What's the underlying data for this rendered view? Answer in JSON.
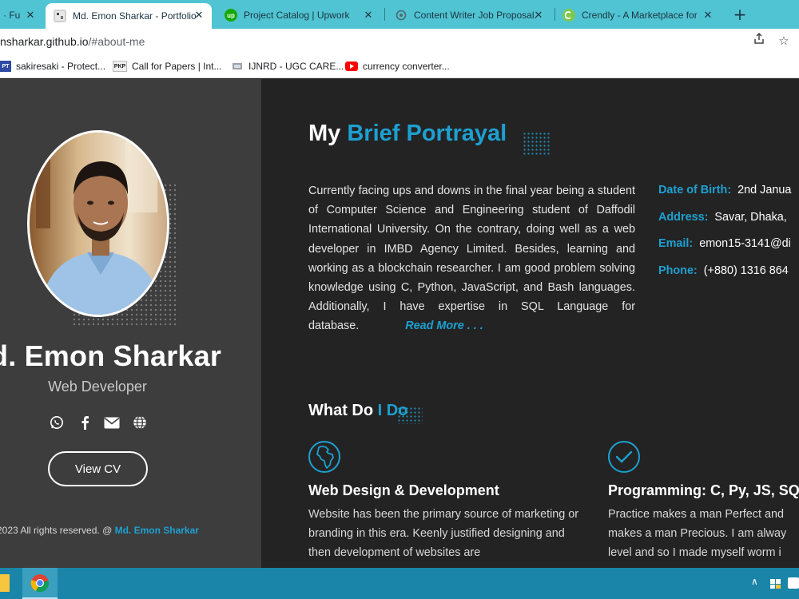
{
  "browser": {
    "tabs": [
      {
        "title": "· Fu",
        "favicon": "generic-icon",
        "active": false
      },
      {
        "title": "Md. Emon Sharkar - Portfolio",
        "favicon": "portfolio-icon",
        "active": true
      },
      {
        "title": "Project Catalog | Upwork",
        "favicon": "upwork-icon",
        "favicon_text": "up",
        "active": false
      },
      {
        "title": "Content Writer Job Proposal.",
        "favicon": "chatgpt-icon",
        "active": false
      },
      {
        "title": "Crendly - A Marketplace for",
        "favicon": "crendly-icon",
        "active": false
      }
    ],
    "url_host": "nsharkar.github.io",
    "url_path": "/#about-me",
    "bookmarks": [
      {
        "label": "sakiresaki - Protect...",
        "icon": "pt-icon",
        "icon_text": "PT"
      },
      {
        "label": "Call for Papers | Int...",
        "icon": "pkp-icon",
        "icon_text": "PKP"
      },
      {
        "label": "IJNRD - UGC CARE...",
        "icon": "ijnrd-icon",
        "icon_text": ""
      },
      {
        "label": "currency converter...",
        "icon": "youtube-icon",
        "icon_text": ""
      }
    ]
  },
  "profile": {
    "name": "d. Emon Sharkar",
    "role": "Web Developer",
    "socials": [
      "whatsapp-icon",
      "facebook-icon",
      "email-icon",
      "globe-icon"
    ],
    "cv_label": "View CV",
    "footer_text": "2023 All rights reserved. @ ",
    "footer_author": "Md. Emon Sharkar"
  },
  "about": {
    "heading_plain": "My ",
    "heading_accent": "Brief Portrayal",
    "bio": "Currently facing ups and downs in the final year being a student of Computer Science and Engineering student of Daffodil International University. On the contrary, doing well as a web developer in IMBD Agency Limited. Besides, learning and working as a blockchain researcher. I am good problem solving knowledge using C, Python, JavaScript, and Bash languages. Additionally, I have expertise in SQL Language for database.",
    "read_more": "Read More . . .",
    "info": [
      {
        "label": "Date of Birth:",
        "value": "2nd Janua"
      },
      {
        "label": "Address:",
        "value": "Savar, Dhaka,"
      },
      {
        "label": "Email:",
        "value": "emon15-3141@di"
      },
      {
        "label": "Phone:",
        "value": "(+880) 1316 864"
      }
    ]
  },
  "services": {
    "heading_plain": "What Do ",
    "heading_accent": "I Do",
    "items": [
      {
        "icon": "globe-africa-icon",
        "title": "Web Design & Development",
        "desc": "Website has been the primary source of marketing or branding in this era. Keenly justified designing and then development of websites are"
      },
      {
        "icon": "check-circle-icon",
        "title": "Programming: C, Py, JS, SQ",
        "desc": "Practice makes a man Perfect and makes a man Precious. I am alway level and so I made myself worm i"
      }
    ]
  },
  "colors": {
    "accent": "#1da0d1",
    "tabstrip": "#50c4d3",
    "left_panel": "#3d3d3d",
    "right_panel": "#232323",
    "taskbar": "#1a85a8"
  }
}
